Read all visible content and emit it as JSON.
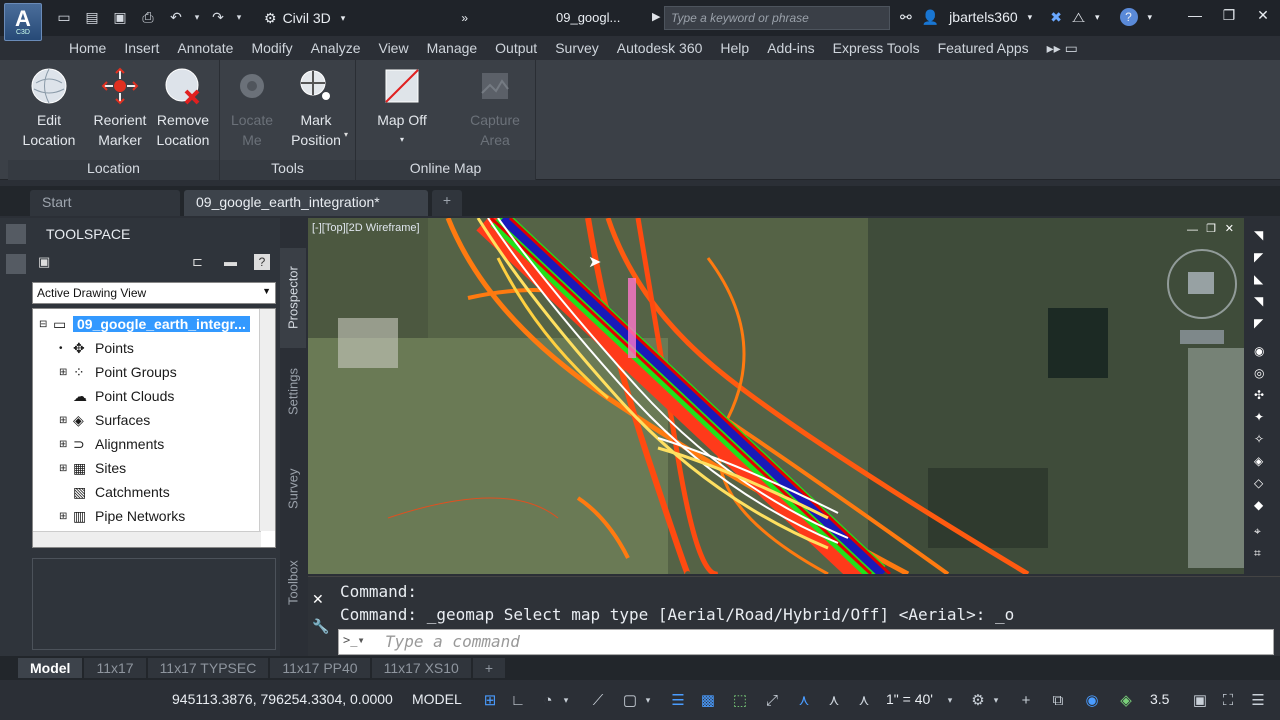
{
  "app": {
    "logo_letter": "A",
    "logo_sub": "C3D"
  },
  "workspace": {
    "name": "Civil 3D"
  },
  "document": {
    "title": "09_googl..."
  },
  "search": {
    "placeholder": "Type a keyword or phrase"
  },
  "user": {
    "name": "jbartels360"
  },
  "ribbon_tabs": [
    "Home",
    "Insert",
    "Annotate",
    "Modify",
    "Analyze",
    "View",
    "Manage",
    "Output",
    "Survey",
    "Autodesk 360",
    "Help",
    "Add-ins",
    "Express Tools",
    "Featured Apps"
  ],
  "ribbon": {
    "location": {
      "title": "Location",
      "edit_l1": "Edit",
      "edit_l2": "Location",
      "reorient_l1": "Reorient",
      "reorient_l2": "Marker",
      "remove_l1": "Remove",
      "remove_l2": "Location"
    },
    "tools": {
      "title": "Tools",
      "locate_l1": "Locate",
      "locate_l2": "Me",
      "mark_l1": "Mark",
      "mark_l2": "Position"
    },
    "online_map": {
      "title": "Online Map",
      "mapoff": "Map Off",
      "capture_l1": "Capture",
      "capture_l2": "Area"
    }
  },
  "doc_tabs": {
    "start": "Start",
    "active": "09_google_earth_integration*"
  },
  "toolspace": {
    "title": "TOOLSPACE",
    "view_combo": "Active Drawing View",
    "root": "09_google_earth_integr...",
    "items": [
      "Points",
      "Point Groups",
      "Point Clouds",
      "Surfaces",
      "Alignments",
      "Sites",
      "Catchments",
      "Pipe Networks"
    ]
  },
  "side_tabs": {
    "prospector": "Prospector",
    "settings": "Settings",
    "survey": "Survey",
    "toolbox": "Toolbox"
  },
  "viewport": {
    "label": "[-][Top][2D Wireframe]"
  },
  "command": {
    "line1": "Command:",
    "line2": "Command: _geomap Select map type [Aerial/Road/Hybrid/Off] <Aerial>: _o",
    "placeholder": "Type a command"
  },
  "layout_tabs": [
    "Model",
    "11x17",
    "11x17 TYPSEC",
    "11x17 PP40",
    "11x17 XS10"
  ],
  "status": {
    "coords": "945113.3876, 796254.3304, 0.0000",
    "model": "MODEL",
    "scale": "1\" = 40'",
    "anno_scale": "3.5"
  },
  "colors": {
    "accent": "#3399ff",
    "road_red": "#ff3a1a",
    "road_green": "#22e01a",
    "road_blue": "#1a1ab8",
    "contour_orange": "#ff7a10"
  }
}
